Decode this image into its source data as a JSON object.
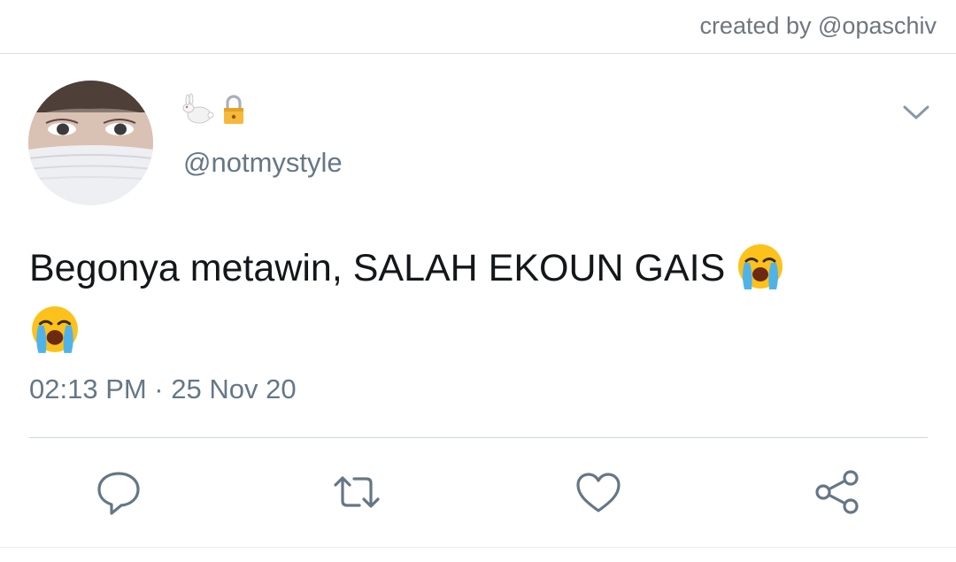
{
  "header": {
    "credit_text": "created by @opaschiv"
  },
  "tweet": {
    "display_name_icons": [
      "rabbit-emoji",
      "lock-emoji"
    ],
    "handle": "@notmystyle",
    "text": "Begonya metawin, SALAH EKOUN GAIS",
    "text_emojis": [
      "loudly-crying-face",
      "loudly-crying-face"
    ],
    "timestamp": "02:13 PM · 25 Nov 20"
  },
  "actions": {
    "icons": [
      "reply-icon",
      "retweet-icon",
      "like-icon",
      "share-icon"
    ]
  },
  "colors": {
    "text_primary": "#14171a",
    "text_secondary": "#657786",
    "divider": "#ccd6dd",
    "icon": "#657786"
  }
}
